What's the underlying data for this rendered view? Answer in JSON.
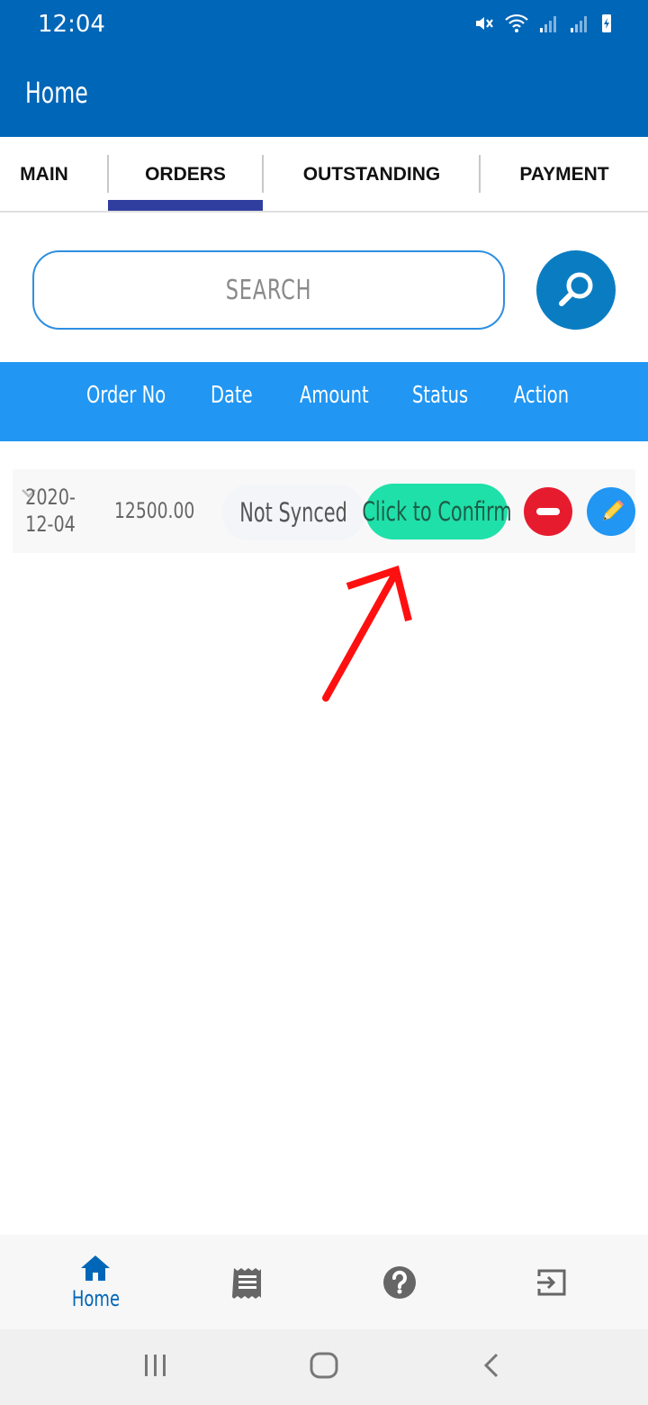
{
  "status_bar": {
    "time": "12:04"
  },
  "app": {
    "title": "Home"
  },
  "tabs": [
    {
      "label": "MAIN"
    },
    {
      "label": "ORDERS"
    },
    {
      "label": "OUTSTANDING"
    },
    {
      "label": "PAYMENT"
    }
  ],
  "search": {
    "placeholder": "SEARCH"
  },
  "table": {
    "headers": [
      "Order No",
      "Date",
      "Amount",
      "Status",
      "Action"
    ],
    "rows": [
      {
        "date": "2020-12-04",
        "amount": "12500.00",
        "status": "Not Synced",
        "confirm_label": "Click to Confirm"
      }
    ]
  },
  "bottom_nav": [
    {
      "label": "Home",
      "icon": "home-icon",
      "active": true
    },
    {
      "label": "",
      "icon": "receipt-icon"
    },
    {
      "label": "",
      "icon": "help-icon"
    },
    {
      "label": "",
      "icon": "logout-icon"
    }
  ],
  "colors": {
    "primary": "#0066b8",
    "header_blue": "#2196f3",
    "tab_indicator": "#303f9f",
    "confirm_green": "#1fe0a8",
    "delete_red": "#e61c2e",
    "annotation_red": "#ff1010"
  }
}
